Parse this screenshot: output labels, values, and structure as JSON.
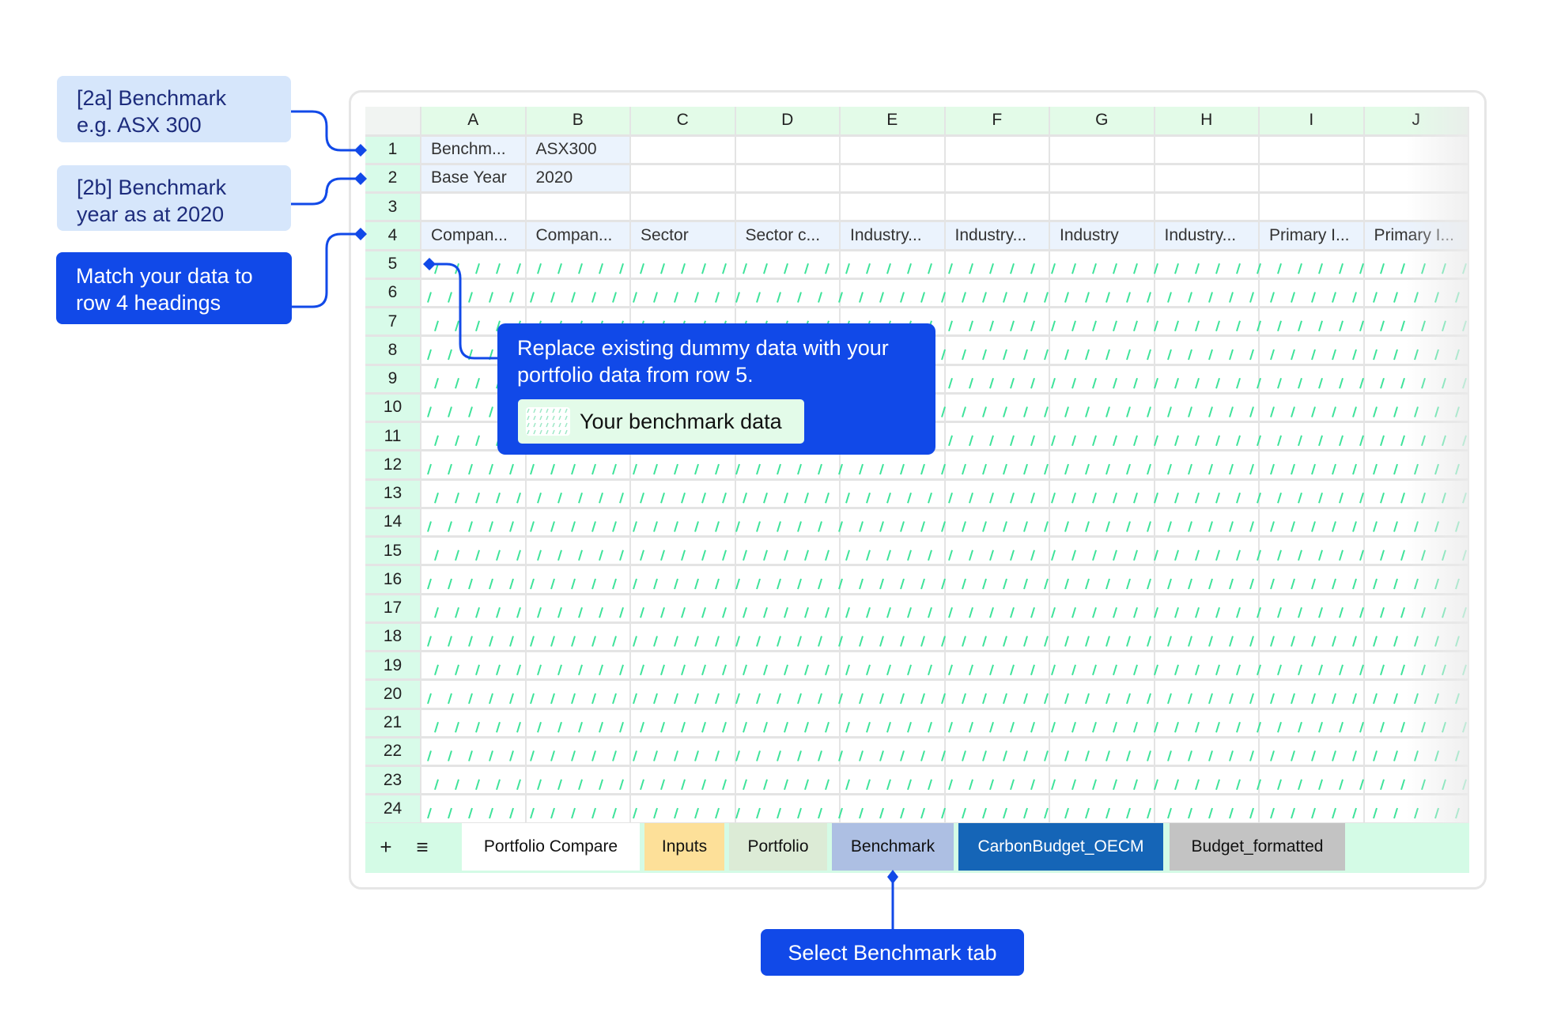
{
  "annotations": {
    "benchmark_2a": [
      "[2a] Benchmark",
      "e.g. ASX 300"
    ],
    "benchmark_2b": [
      "[2b] Benchmark",
      "year as at 2020"
    ],
    "match_headings": [
      "Match your data to",
      "row 4 headings"
    ],
    "replace_data": [
      "Replace existing dummy data with your",
      "portfolio data from row 5."
    ],
    "legend_chip": "Your benchmark data",
    "select_tab": "Select Benchmark tab"
  },
  "sheet": {
    "columns": [
      "A",
      "B",
      "C",
      "D",
      "E",
      "F",
      "G",
      "H",
      "I",
      "J"
    ],
    "rows": [
      "1",
      "2",
      "3",
      "4",
      "5",
      "6",
      "7",
      "8",
      "9",
      "10",
      "11",
      "12",
      "13",
      "14",
      "15",
      "16",
      "17",
      "18",
      "19",
      "20",
      "21",
      "22",
      "23",
      "24"
    ],
    "cells": {
      "row1": [
        "Benchm...",
        "ASX300"
      ],
      "row2": [
        "Base Year",
        "2020"
      ],
      "row4": [
        "Compan...",
        "Compan...",
        "Sector",
        "Sector c...",
        "Industry...",
        "Industry...",
        "Industry",
        "Industry...",
        "Primary I...",
        "Primary I..."
      ]
    },
    "hatch_color": "#3ee39a"
  },
  "tabbar": {
    "add_icon": "plus-icon",
    "menu_icon": "menu-icon",
    "tabs": [
      {
        "label": "Portfolio Compare",
        "color": "#ffffff",
        "text": "#111111"
      },
      {
        "label": "Inputs",
        "color": "#fde099",
        "text": "#111111"
      },
      {
        "label": "Portfolio",
        "color": "#dcebd6",
        "text": "#111111"
      },
      {
        "label": "Benchmark",
        "color": "#adbfe3",
        "text": "#111111"
      },
      {
        "label": "CarbonBudget_OECM",
        "color": "#1565b7",
        "text": "#ffffff"
      },
      {
        "label": "Budget_formatted",
        "color": "#c3c3c3",
        "text": "#111111"
      }
    ]
  },
  "colors": {
    "accent": "#1149e8",
    "light_note": "#d6e6fb"
  }
}
